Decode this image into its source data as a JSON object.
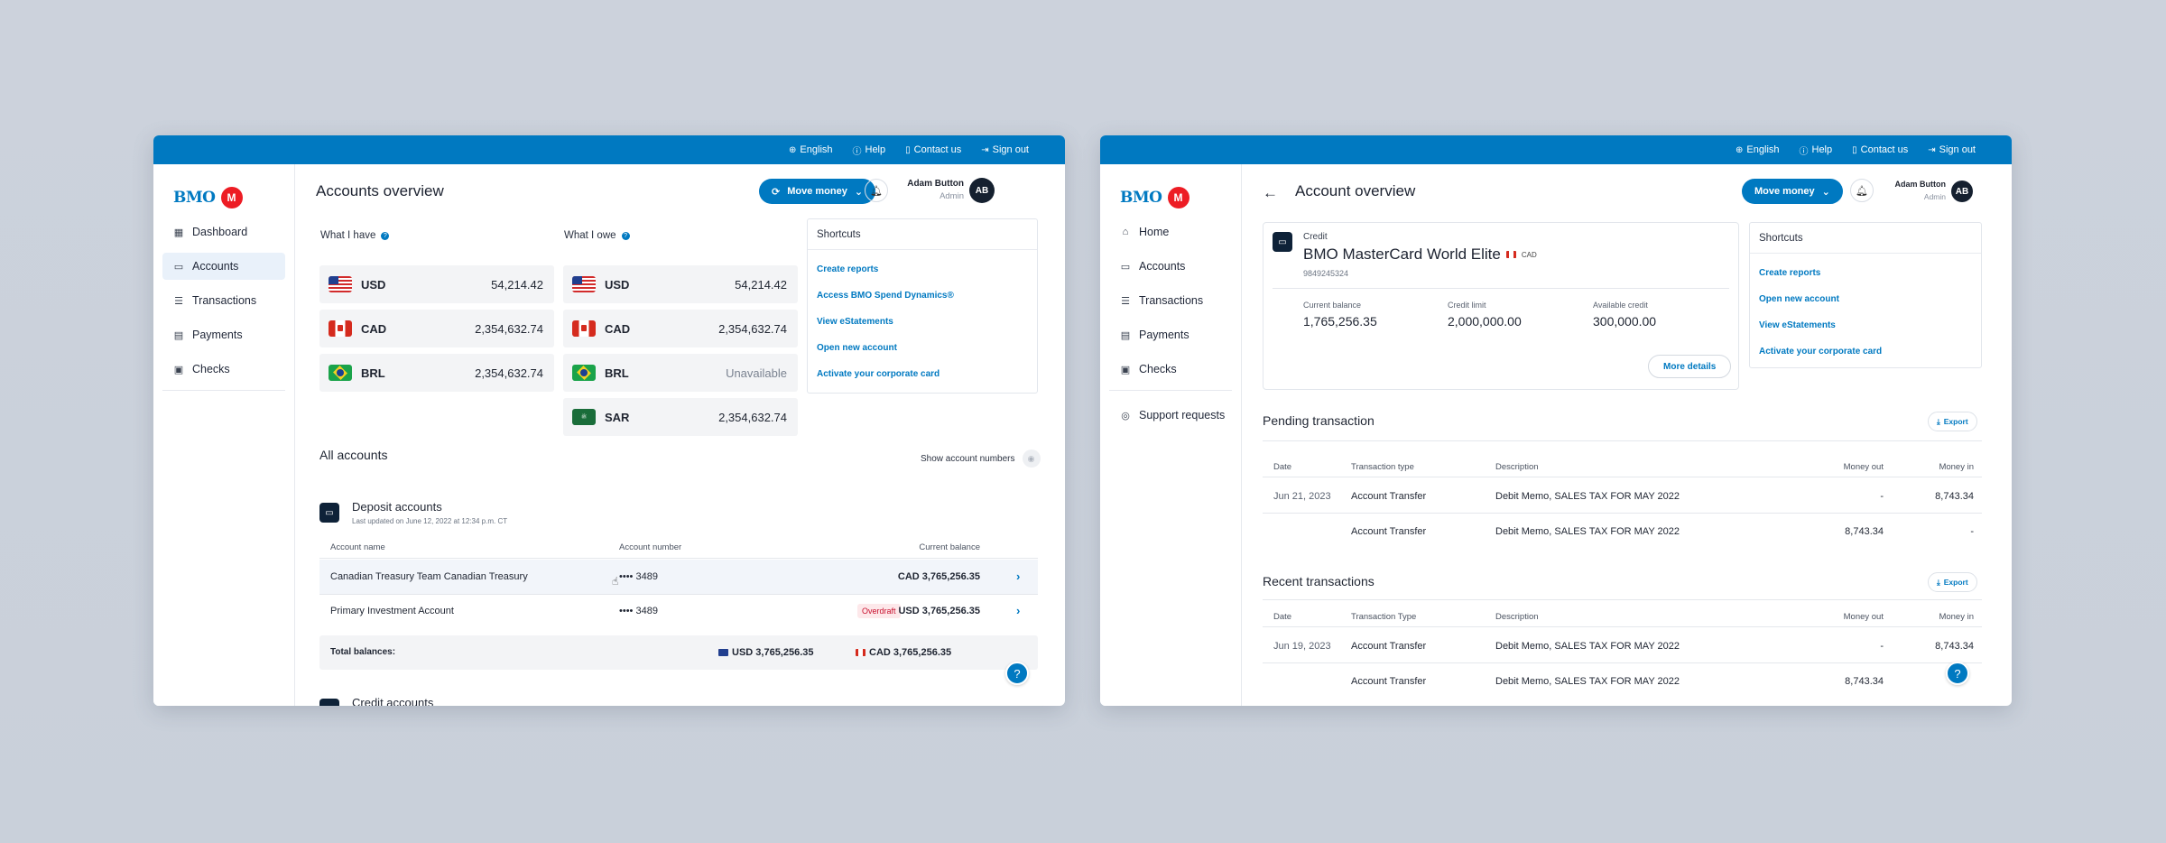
{
  "topbar": {
    "english": "English",
    "help": "Help",
    "contact": "Contact us",
    "signout": "Sign out"
  },
  "brand": {
    "name": "BMO"
  },
  "user": {
    "name": "Adam Button",
    "role": "Admin",
    "initials": "AB"
  },
  "move_money": "Move money",
  "win1": {
    "nav": [
      "Dashboard",
      "Accounts",
      "Transactions",
      "Payments",
      "Checks"
    ],
    "title": "Accounts overview",
    "have_label": "What I have",
    "owe_label": "What I owe",
    "have": [
      {
        "code": "USD",
        "amount": "54,214.42"
      },
      {
        "code": "CAD",
        "amount": "2,354,632.74"
      },
      {
        "code": "BRL",
        "amount": "2,354,632.74"
      }
    ],
    "owe": [
      {
        "code": "USD",
        "amount": "54,214.42"
      },
      {
        "code": "CAD",
        "amount": "2,354,632.74"
      },
      {
        "code": "BRL",
        "amount": "Unavailable"
      },
      {
        "code": "SAR",
        "amount": "2,354,632.74"
      }
    ],
    "shortcuts_title": "Shortcuts",
    "shortcuts": [
      "Create reports",
      "Access BMO Spend Dynamics®",
      "View eStatements",
      "Open new account",
      "Activate your corporate card"
    ],
    "all_accounts": "All accounts",
    "show_numbers": "Show account numbers",
    "deposit_title": "Deposit accounts",
    "deposit_sub": "Last updated on June 12, 2022 at 12:34 p.m. CT",
    "cols": {
      "name": "Account name",
      "number": "Account number",
      "balance": "Current balance"
    },
    "rows": [
      {
        "name": "Canadian Treasury Team Canadian Treasury",
        "number": "•••• 3489",
        "balance": "CAD 3,765,256.35",
        "badge": ""
      },
      {
        "name": "Primary Investment Account",
        "number": "•••• 3489",
        "balance": "USD 3,765,256.35",
        "badge": "Overdraft"
      }
    ],
    "total_label": "Total balances:",
    "total_usd": "USD 3,765,256.35",
    "total_cad": "CAD 3,765,256.35",
    "credit_title": "Credit accounts"
  },
  "win2": {
    "nav": [
      "Home",
      "Accounts",
      "Transactions",
      "Payments",
      "Checks"
    ],
    "support": "Support requests",
    "title": "Account overview",
    "card_kind": "Credit",
    "card_name": "BMO MasterCard World Elite",
    "card_currency": "CAD",
    "card_number": "9849245324",
    "kpis": [
      {
        "label": "Current balance",
        "value": "1,765,256.35"
      },
      {
        "label": "Credit limit",
        "value": "2,000,000.00"
      },
      {
        "label": "Available credit",
        "value": "300,000.00"
      }
    ],
    "more_details": "More details",
    "shortcuts_title": "Shortcuts",
    "shortcuts": [
      "Create reports",
      "Open new account",
      "View eStatements",
      "Activate your corporate card"
    ],
    "export": "Export",
    "pending_title": "Pending transaction",
    "pending_cols": {
      "date": "Date",
      "type": "Transaction type",
      "desc": "Description",
      "out": "Money out",
      "in": "Money in"
    },
    "pending": [
      {
        "date": "Jun 21, 2023",
        "type": "Account Transfer",
        "desc": "Debit Memo, SALES TAX FOR MAY 2022",
        "out": "-",
        "in": "8,743.34"
      },
      {
        "date": "",
        "type": "Account Transfer",
        "desc": "Debit Memo, SALES TAX FOR MAY 2022",
        "out": "8,743.34",
        "in": "-"
      }
    ],
    "recent_title": "Recent transactions",
    "recent_cols": {
      "date": "Date",
      "type": "Transaction Type",
      "desc": "Description",
      "out": "Money out",
      "in": "Money in"
    },
    "recent": [
      {
        "date": "Jun 19, 2023",
        "type": "Account Transfer",
        "desc": "Debit Memo, SALES TAX FOR MAY 2022",
        "out": "-",
        "in": "8,743.34"
      },
      {
        "date": "",
        "type": "Account Transfer",
        "desc": "Debit Memo, SALES TAX FOR MAY 2022",
        "out": "8,743.34",
        "in": ""
      }
    ]
  },
  "colors": {
    "brand_blue": "#0079c1",
    "brand_red": "#ed1c24",
    "overdraft": "#c8102e"
  }
}
